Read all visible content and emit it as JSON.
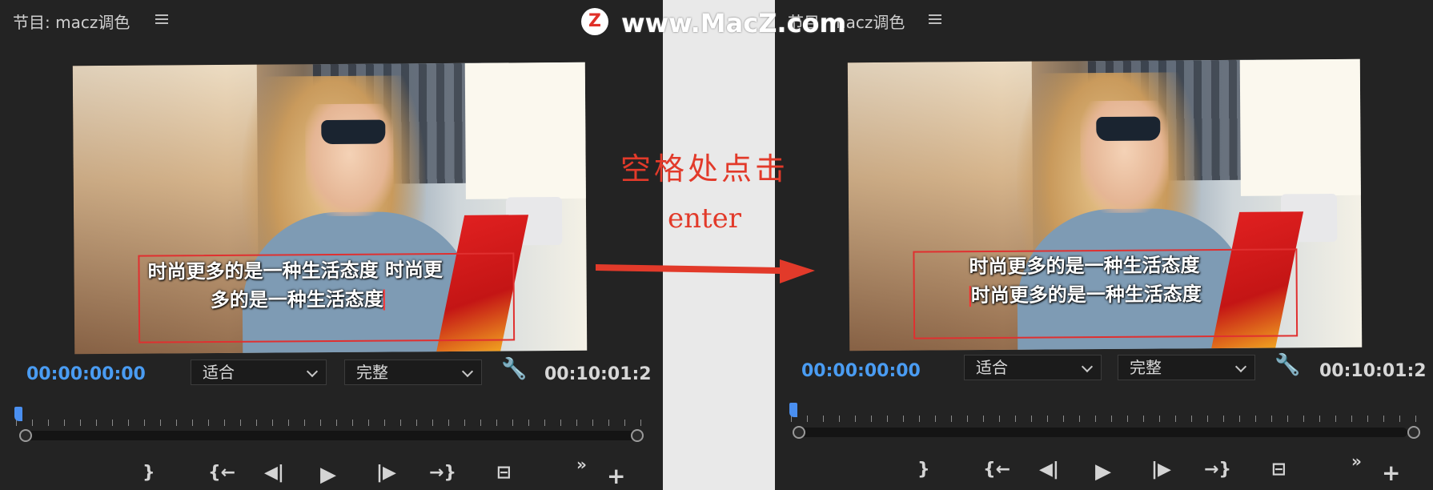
{
  "left_panel": {
    "title": "节目: macz调色",
    "caption_line1": "时尚更多的是一种生活态度 时尚更",
    "caption_line2": "多的是一种生活态度",
    "timecode": "00:00:00:00",
    "fit_select": "适合",
    "resolution_select": "完整",
    "duration": "00:10:01:2"
  },
  "right_panel": {
    "title": "节目: macz调色",
    "caption_line1": "时尚更多的是一种生活态度",
    "caption_line2": "时尚更多的是一种生活态度",
    "timecode": "00:00:00:00",
    "fit_select": "适合",
    "resolution_select": "完整",
    "duration": "00:10:01:2"
  },
  "instruction": {
    "line1": "空格处点击",
    "line2": "enter"
  },
  "watermark": {
    "logo": "Z",
    "text": "www.MacZ.com"
  },
  "transport": {
    "mark_out": "}",
    "prev_edit": "{←",
    "step_back": "◀|",
    "play": "▶",
    "step_forward": "|▶",
    "next_edit": "→}",
    "export_frame": "⊟",
    "more": "»",
    "add": "+"
  },
  "colors": {
    "panel_bg": "#232323",
    "timecode_blue": "#4a9cf2",
    "annotation_red": "#e23a2a",
    "text_box_red": "#e03030"
  },
  "icons": [
    "hamburger-menu-icon",
    "chevron-down-icon",
    "wrench-icon",
    "play-icon",
    "arrow-right-icon"
  ]
}
